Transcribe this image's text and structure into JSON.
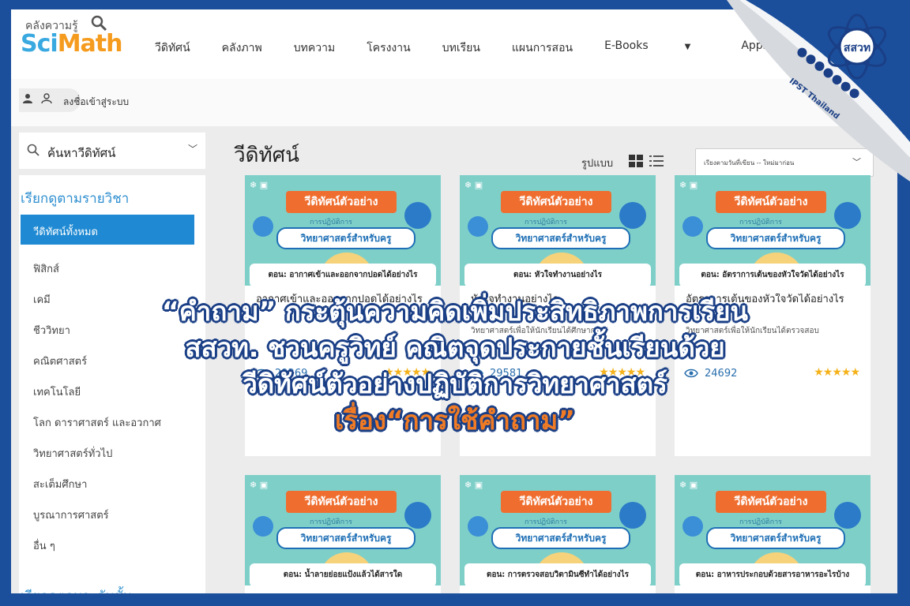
{
  "brand": {
    "tagline": "คลังความรู้",
    "name_part1": "Sci",
    "name_part2": "Math"
  },
  "nav": {
    "items": [
      "วีดิทัศน์",
      "คลังภาพ",
      "บทความ",
      "โครงงาน",
      "บทเรียน",
      "แผนการสอน",
      "E-Books",
      "Apps"
    ]
  },
  "login": {
    "label": "ลงชื่อเข้าสู่ระบบ"
  },
  "sidebar": {
    "search_label": "ค้นหาวีดิทัศน์",
    "heading": "เรียกดูตามรายวิชา",
    "heading2": "เรียกดูตามระดับชั้น",
    "items": [
      "วีดิทัศน์ทั้งหมด",
      "ฟิสิกส์",
      "เคมี",
      "ชีววิทยา",
      "คณิตศาสตร์",
      "เทคโนโลยี",
      "โลก ดาราศาสตร์ และอวกาศ",
      "วิทยาศาสตร์ทั่วไป",
      "สะเต็มศึกษา",
      "บูรณาการศาสตร์",
      "อื่น ๆ"
    ],
    "active_index": 0
  },
  "main": {
    "title": "วีดิทัศน์",
    "view_label": "รูปแบบ",
    "sort_label": "เรียงตามวันที่เขียน -- ใหม่มาก่อน"
  },
  "thumb_text": {
    "badge": "วีดิทัศน์ตัวอย่าง",
    "sub": "การปฏิบัติการ",
    "banner": "วิทยาศาสตร์สำหรับครู"
  },
  "cards": [
    {
      "question": "ตอน: อากาศเข้าและออกจากปอดได้อย่างไร",
      "title": "อากาศเข้าและออกจากปอดได้อย่างไร",
      "desc": "",
      "views": "29269",
      "rating": 5
    },
    {
      "question": "ตอน: หัวใจทำงานอย่างไร",
      "title": "หัวใจทำงานอย่างไร",
      "desc": "วิทยาศาสตร์เพื่อให้นักเรียนได้ศึกษาการ",
      "views": "29581",
      "rating": 5
    },
    {
      "question": "ตอน: อัตราการเต้นของหัวใจวัดได้อย่างไร",
      "title": "อัตราการเต้นของหัวใจวัดได้อย่างไร",
      "desc": "วิทยาศาสตร์เพื่อให้นักเรียนได้ตรวจสอบ",
      "views": "24692",
      "rating": 5
    },
    {
      "question": "ตอน: น้ำลายย่อยแป้งแล้วได้สารใด",
      "title": "",
      "desc": "",
      "views": "",
      "rating": 0
    },
    {
      "question": "ตอน: การตรวจสอบวิตามินซีทำได้อย่างไร",
      "title": "",
      "desc": "",
      "views": "",
      "rating": 0
    },
    {
      "question": "ตอน: อาหารประกอบด้วยสารอาหารอะไรบ้าง",
      "title": "",
      "desc": "",
      "views": "",
      "rating": 0
    }
  ],
  "headline": {
    "line1": "“คำถาม” กระตุ้นความคิดเพิ่มประสิทธิภาพการเรียน",
    "line2": "สสวท. ชวนครูวิทย์ คณิตจุดประกายชั้นเรียนด้วย",
    "line3": "วีดิทัศน์ตัวอย่างปฏิบัติการวิทยาศาสตร์",
    "line4": "เรื่อง“การใช้คำถาม”"
  },
  "corner": {
    "logo_text": "สสวท",
    "handle": "IPST Thailand"
  },
  "colors": {
    "frame": "#1b4f9c",
    "accent_blue": "#1f8ad3",
    "brand_orange": "#f59b1e",
    "star": "#f5b21b",
    "headline_last": "#f07b24"
  }
}
